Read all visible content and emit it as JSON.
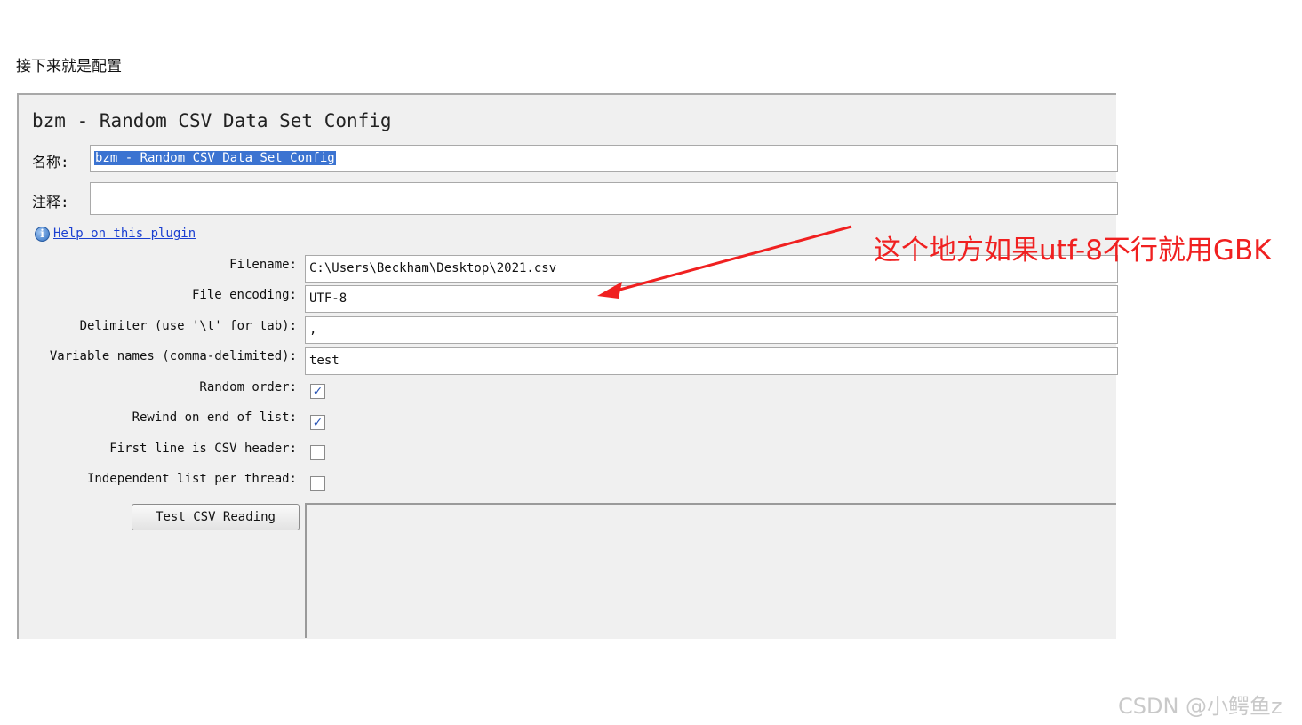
{
  "intro_text": "接下来就是配置",
  "panel": {
    "title": "bzm - Random CSV Data Set Config",
    "name_label": "名称:",
    "name_value": "bzm - Random CSV Data Set Config",
    "comment_label": "注释:",
    "comment_value": "",
    "help_icon": "info-icon",
    "help_link": "Help on this plugin",
    "fields": {
      "filename": {
        "label": "Filename:",
        "value": "C:\\Users\\Beckham\\Desktop\\2021.csv"
      },
      "encoding": {
        "label": "File encoding:",
        "value": "UTF-8"
      },
      "delimiter": {
        "label": "Delimiter (use '\\t' for tab):",
        "value": ","
      },
      "variables": {
        "label": "Variable names (comma-delimited):",
        "value": "test"
      }
    },
    "checkboxes": {
      "random_order": {
        "label": "Random order:",
        "checked": true
      },
      "rewind": {
        "label": "Rewind on end of list:",
        "checked": true
      },
      "header": {
        "label": "First line is CSV header:",
        "checked": false
      },
      "independent": {
        "label": "Independent list per thread:",
        "checked": false
      }
    },
    "test_button": "Test CSV Reading"
  },
  "annotation": "这个地方如果utf-8不行就用GBK",
  "annotation_color": "#f02020",
  "watermark": "CSDN @小鳄鱼z"
}
